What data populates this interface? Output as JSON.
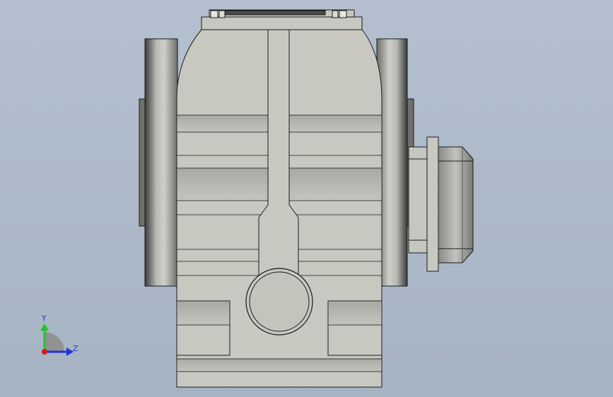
{
  "viewport": {
    "background_top": "#b4c0cf",
    "background_bottom": "#a6b3c3"
  },
  "model": {
    "body_color": "#c8c8c0",
    "edge_color": "#1a1a1a",
    "flange_dark": "#3c3c3c",
    "flange_light": "#c9c9c4"
  },
  "triad": {
    "y_label": "Y",
    "z_label": "Z",
    "y_color": "#22c22a",
    "z_color": "#2233d8",
    "x_color": "#d81a1a"
  }
}
